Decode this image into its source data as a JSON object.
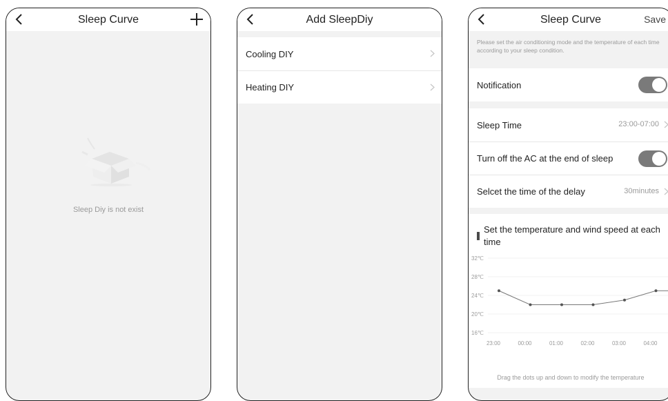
{
  "screen1": {
    "title": "Sleep Curve",
    "back_icon": "chevron-left-icon",
    "add_icon": "plus-icon",
    "empty_message": "Sleep Diy is not exist"
  },
  "screen2": {
    "title": "Add SleepDiy",
    "back_icon": "chevron-left-icon",
    "items": [
      {
        "label": "Cooling DIY"
      },
      {
        "label": "Heating DIY"
      }
    ]
  },
  "screen3": {
    "title": "Sleep Curve",
    "save_label": "Save",
    "hint": "Please set the air conditioning mode and the temperature of each time according to your sleep condition.",
    "notification": {
      "label": "Notification",
      "on": true
    },
    "sleep_time": {
      "label": "Sleep Time",
      "value": "23:00-07:00"
    },
    "turn_off": {
      "label": "Turn off the AC at the end of sleep",
      "on": true
    },
    "delay": {
      "label": "Selcet the time of the delay",
      "value": "30minutes"
    },
    "chart_title": "Set the temperature and wind speed at each time",
    "chart_hint": "Drag the dots up and down to modify the temperature"
  },
  "chart_data": {
    "type": "line",
    "title": "",
    "xlabel": "",
    "ylabel": "",
    "x": [
      "23:00",
      "00:00",
      "01:00",
      "02:00",
      "03:00",
      "04:00"
    ],
    "y_ticks": [
      "32℃",
      "28℃",
      "24℃",
      "20℃",
      "16℃"
    ],
    "ylim": [
      16,
      32
    ],
    "series": [
      {
        "values": [
          25,
          22,
          22,
          22,
          23,
          25,
          25
        ]
      }
    ],
    "grid": true
  }
}
